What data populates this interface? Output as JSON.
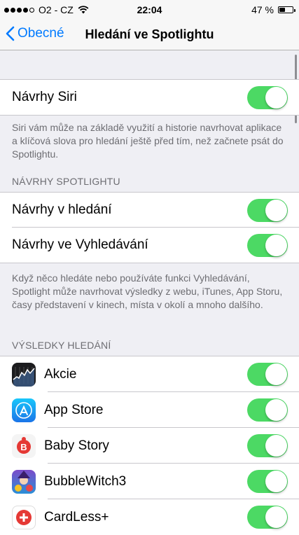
{
  "status_bar": {
    "carrier": "O2 - CZ",
    "time": "22:04",
    "battery": "47 %",
    "battery_level": 0.47
  },
  "nav": {
    "back_label": "Obecné",
    "title": "Hledání ve Spotlightu"
  },
  "siri": {
    "label": "Návrhy Siri",
    "on": true,
    "footer": "Siri vám může na základě využití a historie navrhovat aplikace a klíčová slova pro hledání ještě před tím, než začnete psát do Spotlightu."
  },
  "spotlight": {
    "header": "NÁVRHY SPOTLIGHTU",
    "items": [
      {
        "label": "Návrhy v hledání",
        "on": true
      },
      {
        "label": "Návrhy ve Vyhledávání",
        "on": true
      }
    ],
    "footer": "Když něco hledáte nebo používáte funkci Vyhledávání, Spotlight může navrhovat výsledky z webu, iTunes, App Storu, časy představení v kinech, místa v okolí a mnoho dalšího."
  },
  "results": {
    "header": "VÝSLEDKY HLEDÁNÍ",
    "apps": [
      {
        "label": "Akcie",
        "icon": "stocks-icon",
        "on": true
      },
      {
        "label": "App Store",
        "icon": "app-store-icon",
        "on": true
      },
      {
        "label": "Baby Story",
        "icon": "baby-story-icon",
        "on": true
      },
      {
        "label": "BubbleWitch3",
        "icon": "bubble-witch-icon",
        "on": true
      },
      {
        "label": "CardLess+",
        "icon": "cardless-icon",
        "on": true
      }
    ]
  },
  "colors": {
    "accent": "#007aff",
    "toggle_on": "#4cd964",
    "background": "#efeff4"
  }
}
